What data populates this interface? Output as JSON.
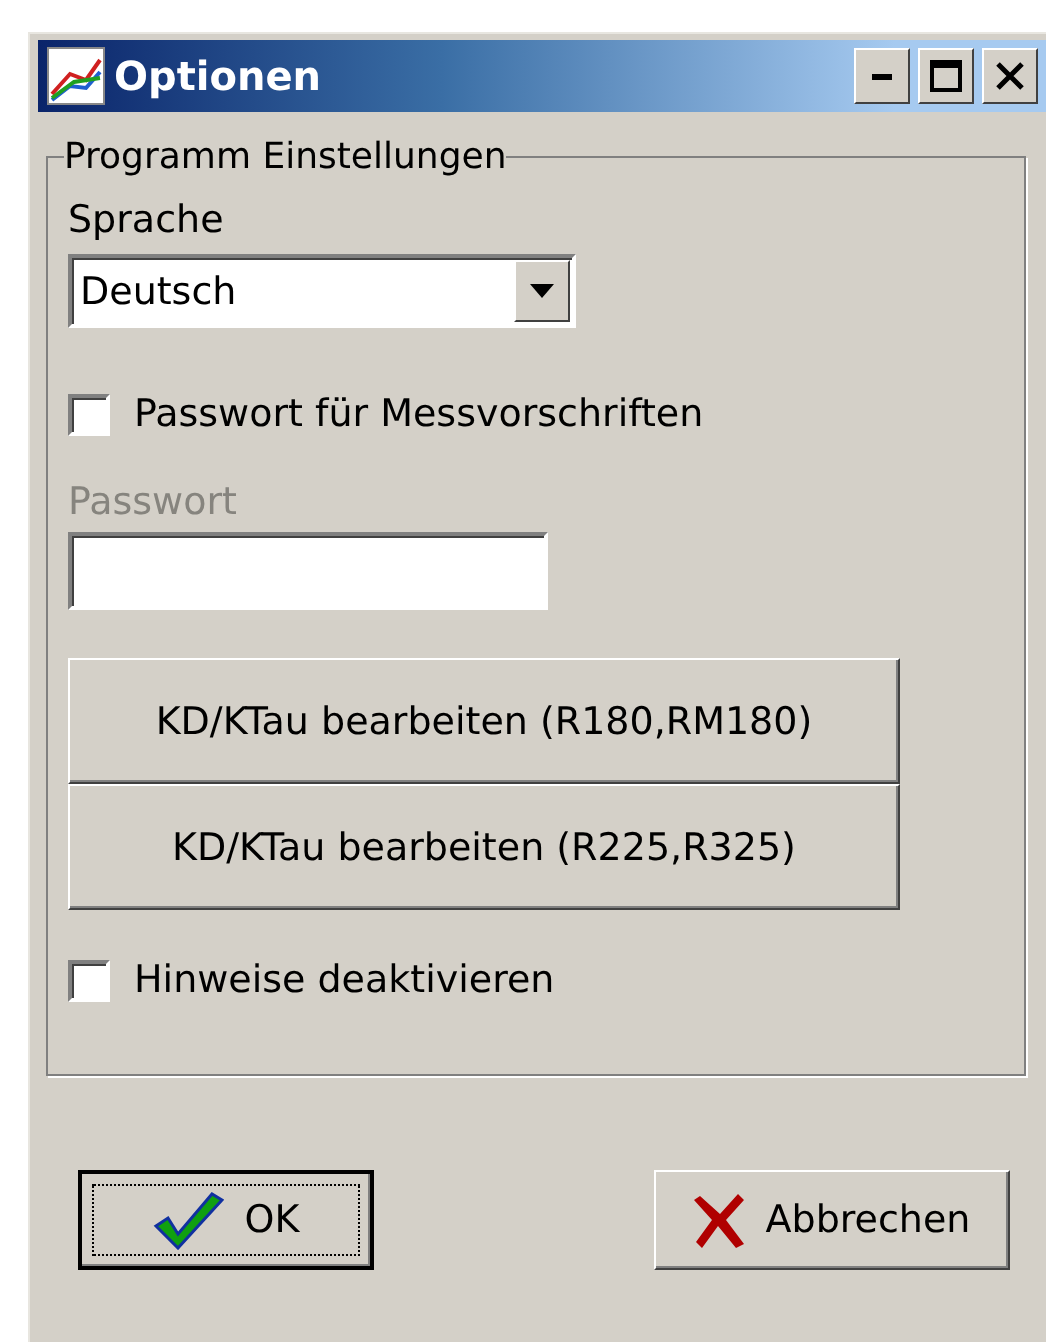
{
  "window": {
    "title": "Optionen"
  },
  "group": {
    "title": "Programm Einstellungen",
    "language": {
      "label": "Sprache",
      "value": "Deutsch"
    },
    "password_checkbox": {
      "label": "Passwort für Messvorschriften",
      "checked": false
    },
    "password": {
      "label": "Passwort",
      "disabled": true
    },
    "edit_buttons": [
      "KD/KTau bearbeiten (R180,RM180)",
      "KD/KTau bearbeiten (R225,R325)"
    ],
    "hints_checkbox": {
      "label": "Hinweise deaktivieren",
      "checked": false
    }
  },
  "buttons": [
    {
      "kind": "ok",
      "label": "OK",
      "default": true
    },
    {
      "kind": "cancel",
      "label": "Abbrechen",
      "default": false
    }
  ]
}
